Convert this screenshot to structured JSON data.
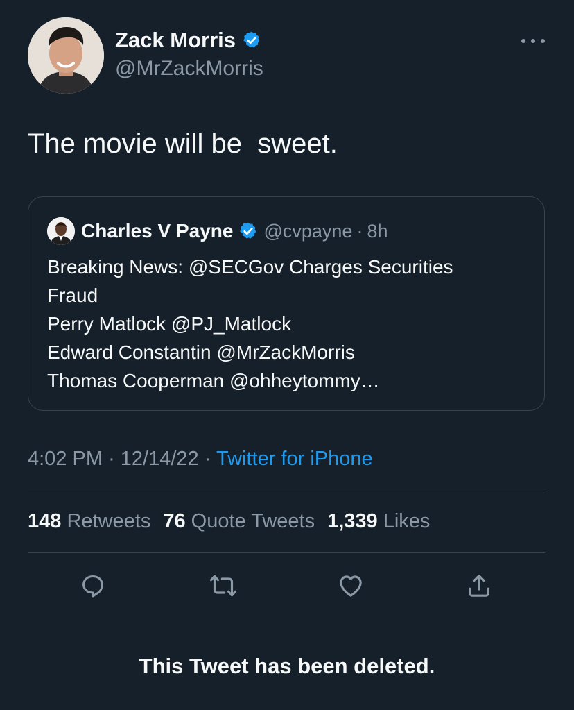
{
  "author": {
    "display_name": "Zack Morris",
    "handle": "@MrZackMorris",
    "verified": true,
    "avatar_icon": "user-avatar-photo"
  },
  "tweet": {
    "text": "The movie will be  sweet.",
    "timestamp": "4:02 PM",
    "date": "12/14/22",
    "separator": "·",
    "source": "Twitter for iPhone"
  },
  "quote": {
    "display_name": "Charles V Payne",
    "handle": "@cvpayne",
    "separator": "·",
    "time": "8h",
    "verified": true,
    "lines": [
      "Breaking News: @SECGov Charges Securities",
      "Fraud",
      "Perry Matlock @PJ_Matlock",
      "Edward Constantin @MrZackMorris",
      "Thomas Cooperman @ohheytommy…"
    ]
  },
  "stats": {
    "retweets_count": "148",
    "retweets_label": "Retweets",
    "quotes_count": "76",
    "quotes_label": "Quote Tweets",
    "likes_count": "1,339",
    "likes_label": "Likes"
  },
  "actions": [
    "reply-icon",
    "retweet-icon",
    "like-icon",
    "share-icon"
  ],
  "footer": {
    "deleted_notice": "This Tweet has been deleted."
  },
  "colors": {
    "background": "#15202b",
    "text_primary": "#f7f9f9",
    "text_secondary": "#8b98a5",
    "accent": "#1d9bf0",
    "border": "#38444d"
  }
}
